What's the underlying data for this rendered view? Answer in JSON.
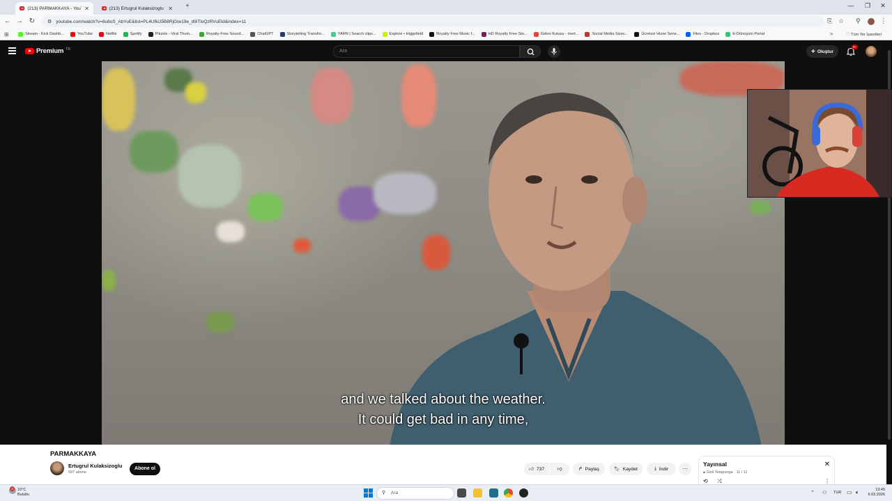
{
  "browser": {
    "tabs": [
      {
        "title": "(213) PARMAKKAYA - YouT...",
        "active": true
      },
      {
        "title": "(213) Ertugrul Kulaksizoglu - Yo...",
        "active": false
      }
    ],
    "url": "youtube.com/watch?v=6u8oS_AbYuE&list=PL4UfkiJ5B8RjGiw19e_d9iTloQzRVuEtd&index=11",
    "bookmarks": [
      {
        "label": "Stream - Kick Dashb...",
        "color": "#53fc18"
      },
      {
        "label": "YouTube",
        "color": "#ff0000"
      },
      {
        "label": "Netflix",
        "color": "#e50914"
      },
      {
        "label": "Spotify",
        "color": "#1db954"
      },
      {
        "label": "Pikzels - Viral Thum...",
        "color": "#222222"
      },
      {
        "label": "Royalty-Free Sound...",
        "color": "#3fa535"
      },
      {
        "label": "ChatGPT",
        "color": "#555555"
      },
      {
        "label": "Storytelling Transfor...",
        "color": "#2a3a6a"
      },
      {
        "label": "YARN | Search clips...",
        "color": "#3ecf8e"
      },
      {
        "label": "Explore • Higgsfield",
        "color": "#c6f000"
      },
      {
        "label": "Royalty Free Music f...",
        "color": "#111111"
      },
      {
        "label": "HD Royalty Free Sto...",
        "color": "#7a1f5c"
      },
      {
        "label": "Gelen Kutusu - mert...",
        "color": "#ea4335"
      },
      {
        "label": "Social Media Sizes...",
        "color": "#c0392b"
      },
      {
        "label": "Ücretsiz Hisse Sene...",
        "color": "#111111"
      },
      {
        "label": "Files - Dropbox",
        "color": "#0061ff"
      },
      {
        "label": "E-Dönüşüm Portal",
        "color": "#2ecc71"
      }
    ],
    "all_bookmarks_label": "Tüm Yer İşaretleri"
  },
  "youtube": {
    "logo_text": "Premium",
    "logo_region": "TR",
    "search_placeholder": "Ara",
    "create_label": "Oluştur",
    "notification_count": "9+"
  },
  "video": {
    "subtitle_line1": "and we talked about the weather.",
    "subtitle_line2": "It could get bad in any time,"
  },
  "below": {
    "title": "PARMAKKAYA",
    "channel_name": "Ertugrul Kulaksizoglu",
    "subscribers": "597 abone",
    "subscribe_label": "Abone ol",
    "like_count": "737",
    "share_label": "Paylaş",
    "save_label": "Kaydet",
    "download_label": "İndir"
  },
  "playlist": {
    "title": "Yayınsal",
    "subtitle": "Gizli  Yetapunga · 11 / 11"
  },
  "taskbar": {
    "weather_temp": "10°C",
    "weather_desc": "Bulutlu",
    "search_placeholder": "Ara",
    "language": "TUR",
    "time": "13:45",
    "date": "6.03.2026",
    "weather_badge": "3"
  }
}
